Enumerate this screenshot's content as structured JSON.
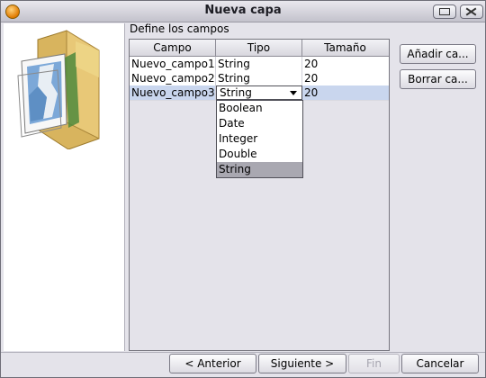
{
  "window": {
    "title": "Nueva capa"
  },
  "main": {
    "section_label": "Define los campos"
  },
  "table": {
    "headers": [
      "Campo",
      "Tipo",
      "Tamaño"
    ],
    "rows": [
      {
        "campo": "Nuevo_campo1",
        "tipo": "String",
        "tamano": "20"
      },
      {
        "campo": "Nuevo_campo2",
        "tipo": "String",
        "tamano": "20"
      },
      {
        "campo": "Nuevo_campo3",
        "tipo": "String",
        "tamano": "20"
      }
    ],
    "type_options": [
      "Boolean",
      "Date",
      "Integer",
      "Double",
      "String"
    ],
    "selected_option": "String"
  },
  "side_buttons": {
    "add_label": "Añadir ca...",
    "delete_label": "Borrar ca..."
  },
  "nav": {
    "back_label": "< Anterior",
    "next_label": "Siguiente >",
    "finish_label": "Fin",
    "cancel_label": "Cancelar"
  },
  "icons": {
    "app": "app-orange-circle-icon",
    "minimize": "minimize-icon",
    "close": "close-icon",
    "folder": "folder-with-map-icon"
  },
  "colors": {
    "selected_row": "#c9d6ee",
    "dropdown_selected": "#a9a8b1"
  }
}
